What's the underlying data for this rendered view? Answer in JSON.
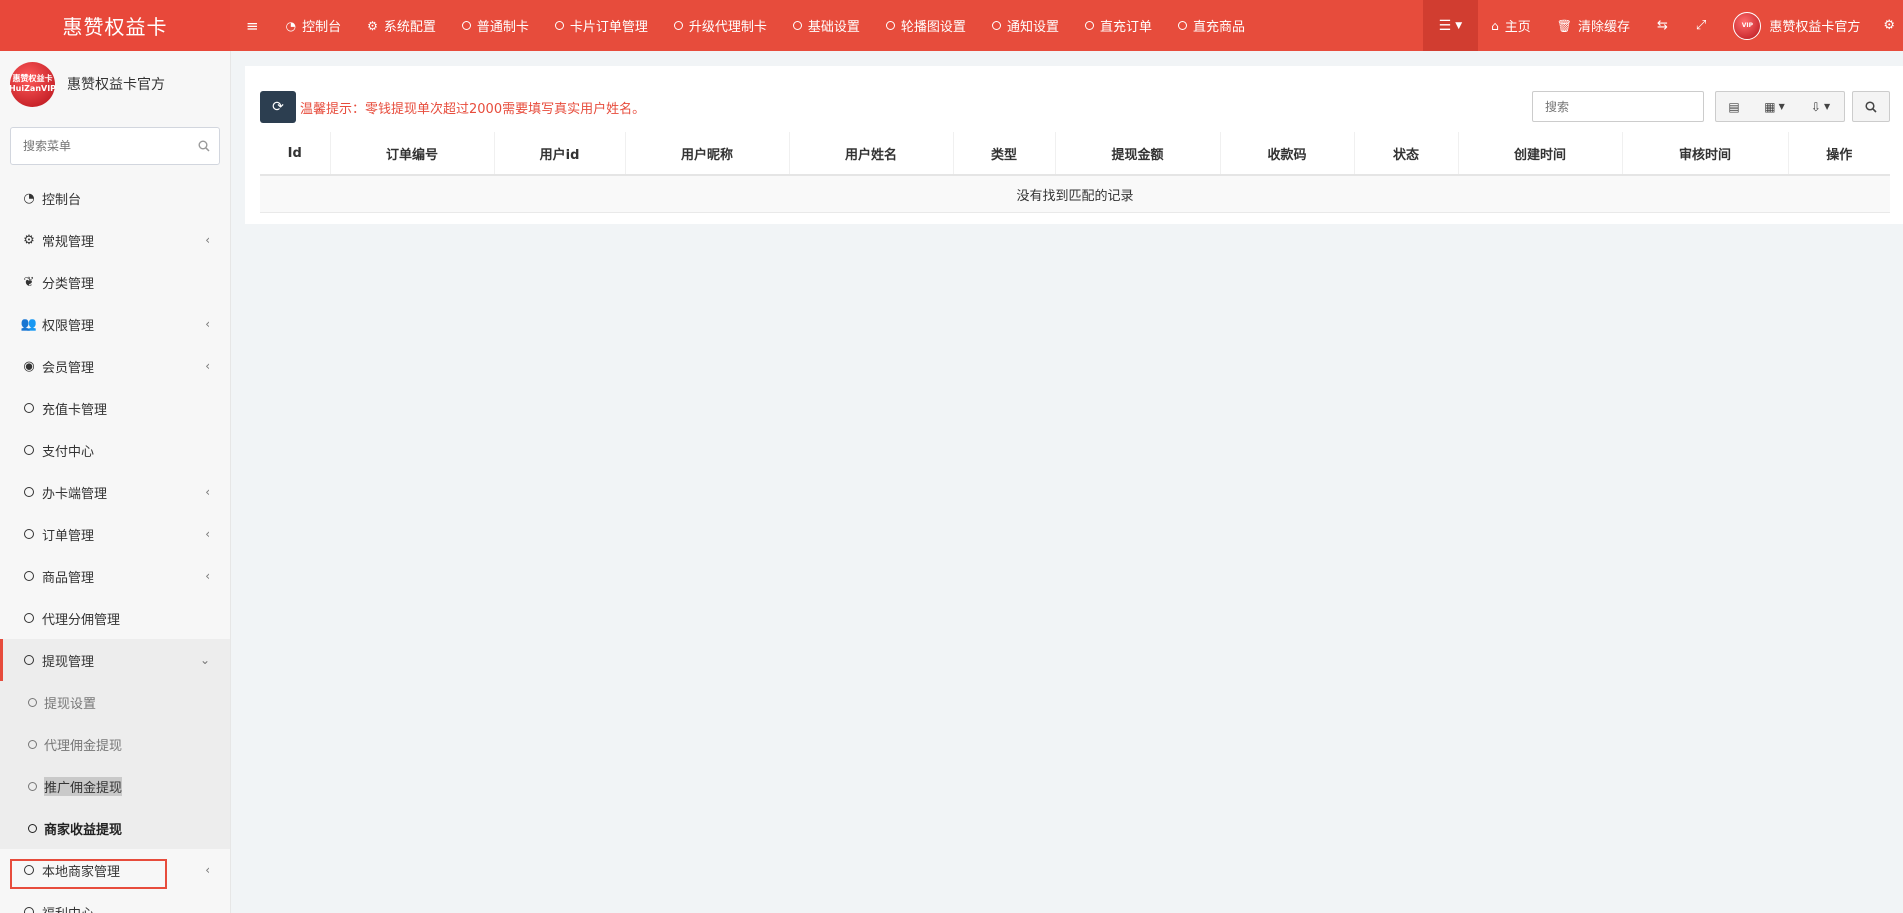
{
  "app": {
    "brand": "惠赞权益卡"
  },
  "topnav": {
    "left": [
      {
        "icon": "menu-icon",
        "label": ""
      },
      {
        "icon": "dashboard-icon",
        "label": "控制台"
      },
      {
        "icon": "gear-icon",
        "label": "系统配置"
      },
      {
        "icon": "circle-icon",
        "label": "普通制卡"
      },
      {
        "icon": "circle-icon",
        "label": "卡片订单管理"
      },
      {
        "icon": "circle-icon",
        "label": "升级代理制卡"
      },
      {
        "icon": "circle-icon",
        "label": "基础设置"
      },
      {
        "icon": "circle-icon",
        "label": "轮播图设置"
      },
      {
        "icon": "circle-icon",
        "label": "通知设置"
      },
      {
        "icon": "circle-icon",
        "label": "直充订单"
      },
      {
        "icon": "circle-icon",
        "label": "直充商品"
      }
    ],
    "right": {
      "home": "主页",
      "clear_cache": "清除缓存",
      "user": "惠赞权益卡官方"
    }
  },
  "sidebar": {
    "user_name": "惠赞权益卡官方",
    "avatar_text": "惠赞权益卡 HuiZanVIP",
    "search_placeholder": "搜索菜单",
    "items": [
      {
        "icon": "dashboard-icon",
        "label": "控制台",
        "arrow": ""
      },
      {
        "icon": "gears-icon",
        "label": "常规管理",
        "arrow": "‹"
      },
      {
        "icon": "leaf-icon",
        "label": "分类管理",
        "arrow": ""
      },
      {
        "icon": "users-icon",
        "label": "权限管理",
        "arrow": "‹"
      },
      {
        "icon": "user-circle-icon",
        "label": "会员管理",
        "arrow": "‹"
      },
      {
        "icon": "circle-icon",
        "label": "充值卡管理",
        "arrow": ""
      },
      {
        "icon": "circle-icon",
        "label": "支付中心",
        "arrow": ""
      },
      {
        "icon": "circle-icon",
        "label": "办卡端管理",
        "arrow": "‹"
      },
      {
        "icon": "circle-icon",
        "label": "订单管理",
        "arrow": "‹"
      },
      {
        "icon": "circle-icon",
        "label": "商品管理",
        "arrow": "‹"
      },
      {
        "icon": "circle-icon",
        "label": "代理分佣管理",
        "arrow": ""
      },
      {
        "icon": "circle-icon",
        "label": "提现管理",
        "arrow": "⌄"
      }
    ],
    "subitems": [
      {
        "label": "提现设置"
      },
      {
        "label": "代理佣金提现"
      },
      {
        "label": "推广佣金提现"
      },
      {
        "label": "商家收益提现"
      }
    ],
    "tail_items": [
      {
        "icon": "circle-icon",
        "label": "本地商家管理",
        "arrow": "‹"
      },
      {
        "icon": "circle-icon",
        "label": "福利中心",
        "arrow": ""
      }
    ]
  },
  "content": {
    "notice": "温馨提示：零钱提现单次超过2000需要填写真实用户姓名。",
    "search_placeholder": "搜索",
    "columns": [
      "Id",
      "订单编号",
      "用户id",
      "用户昵称",
      "用户姓名",
      "类型",
      "提现金额",
      "收款码",
      "状态",
      "创建时间",
      "审核时间",
      "操作"
    ],
    "empty_text": "没有找到匹配的记录"
  },
  "colors": {
    "accent": "#e74c3c",
    "dark_button": "#2c3e50",
    "sidebar_bg": "#f7f7f7"
  }
}
